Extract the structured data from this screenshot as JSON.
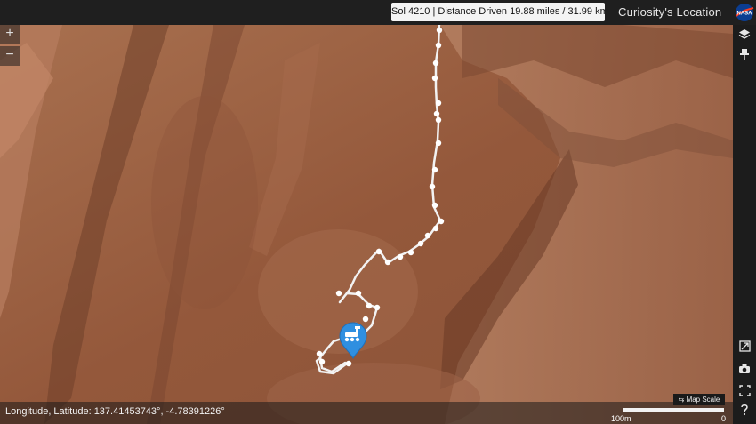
{
  "header": {
    "title": "Curiosity's Location",
    "sol_info": "Sol 4210 | Distance Driven 19.88 miles / 31.99 km",
    "logo_label": "NASA"
  },
  "map": {
    "zoom_in_label": "+",
    "zoom_out_label": "−",
    "coordinates_text": "Longitude, Latitude: 137.41453743°, -4.78391226°",
    "scale_button_label": "Map Scale",
    "scale_start_label": "0",
    "scale_end_label": "100m",
    "colors": {
      "terrain": "#9a6244",
      "route": "#f2f2f2",
      "rover_marker": "#2f8fe0"
    }
  },
  "toolbar": {
    "icons": [
      "layers-icon",
      "pin-icon",
      "fullscreen-icon",
      "camera-icon",
      "help-icon"
    ]
  }
}
